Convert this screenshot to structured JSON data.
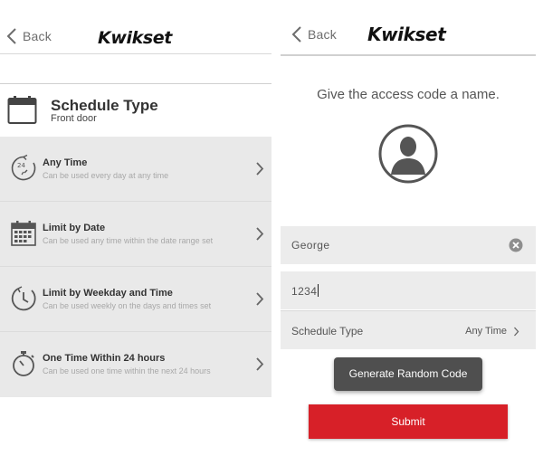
{
  "colors": {
    "submit_red": "#d72028",
    "generate_gray": "#4f4f4f",
    "list_bg": "#e9e9e9"
  },
  "left_screen": {
    "nav": {
      "back_label": "Back",
      "logo": "Kwikset"
    },
    "schedule_header": {
      "title": "Schedule Type",
      "subtitle": "Front door",
      "icon": "calendar-icon"
    },
    "options": [
      {
        "title": "Any Time",
        "subtitle": "Can be used every day at any time",
        "icon": "clock-24-icon"
      },
      {
        "title": "Limit by Date",
        "subtitle": "Can be used any time within the date range set",
        "icon": "calendar-grid-icon"
      },
      {
        "title": "Limit by Weekday and Time",
        "subtitle": "Can be used weekly on the days and times set",
        "icon": "clock-icon"
      },
      {
        "title": "One Time Within 24 hours",
        "subtitle": "Can be used one time within the next 24 hours",
        "icon": "stopwatch-icon"
      }
    ]
  },
  "right_screen": {
    "nav": {
      "back_label": "Back",
      "logo": "Kwikset"
    },
    "prompt": "Give the access code a name.",
    "name_field": {
      "value": "George"
    },
    "code_field": {
      "value": "1234"
    },
    "schedule_row": {
      "label": "Schedule Type",
      "value": "Any Time"
    },
    "generate_button": "Generate Random Code",
    "submit_button": "Submit"
  }
}
